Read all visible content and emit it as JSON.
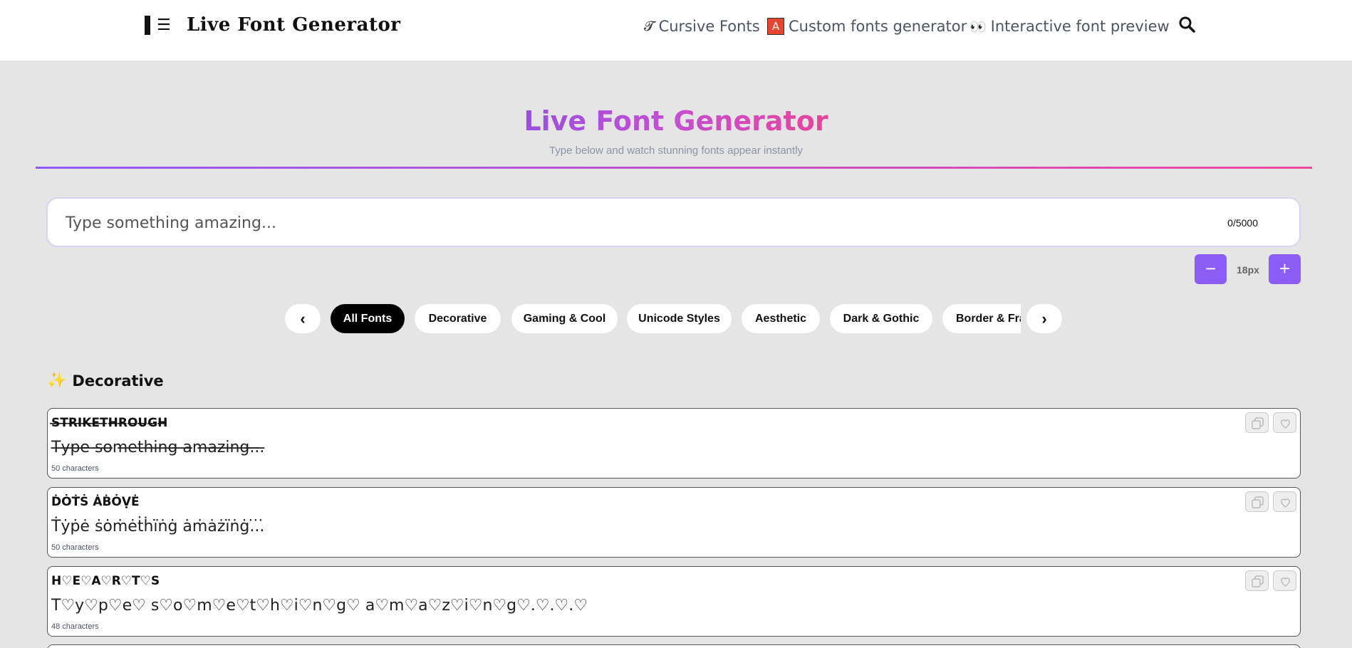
{
  "header": {
    "logo_lines": "☰",
    "logo_text": "Live Font Generator",
    "nav": [
      {
        "icon": "𝓣",
        "icon_name": "cursive-icon",
        "label": "Cursive Fonts"
      },
      {
        "icon": "A",
        "icon_name": "letter-a-icon",
        "label": "Custom fonts generator"
      },
      {
        "icon": "👀",
        "icon_name": "eyes-icon",
        "label": "Interactive font preview"
      }
    ]
  },
  "hero": {
    "title": "Live Font Generator",
    "subtitle": "Type below and watch stunning fonts appear instantly"
  },
  "input": {
    "placeholder": "Type something amazing...",
    "value": "",
    "count": "0/5000"
  },
  "size_control": {
    "minus": "−",
    "plus": "+",
    "value": "18px"
  },
  "tabs": {
    "prev": "‹",
    "next": "›",
    "items": [
      "All Fonts",
      "Decorative",
      "Gaming & Cool",
      "Unicode Styles",
      "Aesthetic",
      "Dark & Gothic",
      "Border & Frame"
    ],
    "active": "All Fonts"
  },
  "section": {
    "icon": "✨",
    "title": "Decorative"
  },
  "cards": [
    {
      "name": "S̶T̶R̶I̶K̶E̶T̶H̶R̶O̶U̶G̶H̶",
      "sample": "T̶y̶p̶e̶ ̶s̶o̶m̶e̶t̶h̶i̶n̶g̶ ̶a̶m̶a̶z̶i̶n̶g̶.̶.̶.̶",
      "count": "50 characters"
    },
    {
      "name": "ḊȮṪṠ ȦḂȮṾĖ",
      "sample": "Ṫẏṗė ṡȯṁėṫḣïṅġ ȧṁȧżïṅġ.̇.̇.̇",
      "count": "50 characters"
    },
    {
      "name": "H♡E♡A♡R♡T♡S",
      "sample": "T♡y♡p♡e♡ s♡o♡m♡e♡t♡h♡i♡n♡g♡ a♡m♡a♡z♡i♡n♡g♡.♡.♡.♡",
      "count": "48 characters"
    }
  ],
  "colors": {
    "accent": "#8b5cf6",
    "title_gradient_start": "#9b4fe0",
    "title_gradient_end": "#e8449a",
    "page_bg": "#e5e5e5"
  }
}
